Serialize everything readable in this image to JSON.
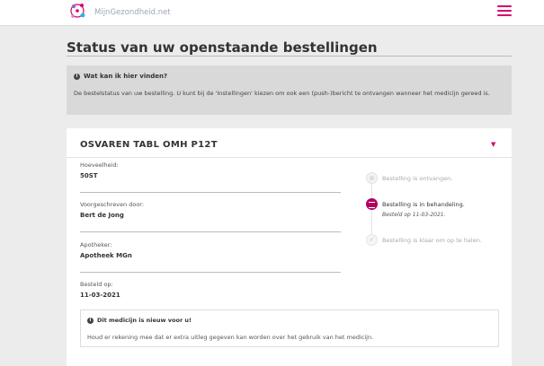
{
  "header": {
    "logo_text": "MijnGezondheid.net",
    "brand_color": "#d6006f"
  },
  "page": {
    "title": "Status van uw openstaande bestellingen"
  },
  "info": {
    "heading": "Wat kan ik hier vinden?",
    "text": "De bestelstatus van uw bestelling. U kunt bij de 'Instellingen' kiezen om ook een (push-)bericht te ontvangen wanneer het medicijn gereed is."
  },
  "order": {
    "title": "OSVAREN TABL OMH P12T",
    "fields": [
      {
        "label": "Hoeveelheid:",
        "value": "50ST"
      },
      {
        "label": "Voorgeschreven door:",
        "value": "Bert de Jong"
      },
      {
        "label": "Apotheker:",
        "value": "Apotheek MGn"
      },
      {
        "label": "Besteld op:",
        "value": "11-03-2021"
      }
    ],
    "notice": {
      "heading": "Dit medicijn is nieuw voor u!",
      "text": "Houd er rekening mee dat er extra uitleg gegeven kan worden over het gebruik van het medicijn."
    },
    "status": [
      {
        "label": "Bestelling is ontvangen.",
        "state": "done"
      },
      {
        "label": "Bestelling is in behandeling.",
        "date": "Besteld op 11-03-2021.",
        "state": "active"
      },
      {
        "label": "Bestelling is klaar om op te halen.",
        "state": "todo"
      }
    ]
  }
}
